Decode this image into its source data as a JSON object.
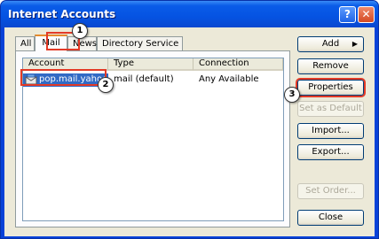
{
  "window": {
    "title": "Internet Accounts",
    "help_glyph": "?",
    "close_glyph": "✕"
  },
  "tabs": [
    {
      "label": "All"
    },
    {
      "label": "Mail",
      "active": true
    },
    {
      "label": "News"
    },
    {
      "label": "Directory Service"
    }
  ],
  "list": {
    "columns": [
      "Account",
      "Type",
      "Connection"
    ],
    "rows": [
      {
        "account": "pop.mail.yahoo.c...",
        "type": "mail (default)",
        "connection": "Any Available",
        "selected": true
      }
    ]
  },
  "buttons": {
    "add": "Add",
    "add_arrow": "▶",
    "remove": "Remove",
    "properties": "Properties",
    "set_as_default": "Set as Default",
    "import": "Import...",
    "export": "Export...",
    "set_order": "Set Order...",
    "close": "Close"
  },
  "callouts": [
    "1",
    "2",
    "3"
  ],
  "colors": {
    "titlebar": "#0553e2",
    "selection": "#316ac5",
    "highlight": "#e33a26",
    "dialog_bg": "#ece9d8"
  },
  "icons": {
    "account_icon": "mail-account-icon"
  }
}
